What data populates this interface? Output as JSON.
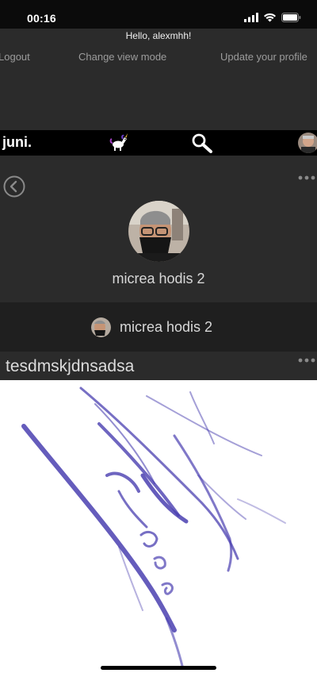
{
  "status_bar": {
    "time": "00:16",
    "icons": [
      "signal-icon",
      "wifi-icon",
      "battery-icon"
    ]
  },
  "header": {
    "greeting": "Hello, alexmhh!",
    "menu": {
      "logout_label": "Logout",
      "change_view_label": "Change view mode",
      "update_profile_label": "Update your profile"
    }
  },
  "nav": {
    "logo": "juni.",
    "icons": [
      "unicorn-icon",
      "search-icon",
      "avatar"
    ]
  },
  "profile": {
    "name": "micrea hodis 2",
    "back_icon": "chevron-left-circle-icon",
    "more_icon": "ellipsis-icon"
  },
  "post": {
    "author_name": "micrea hodis 2",
    "title": "tesdmskjdnsadsa",
    "more_icon": "ellipsis-icon",
    "image_description_icon": "handwriting-scribble-image"
  },
  "colors": {
    "background": "#2b2b2b",
    "nav_background": "#000000",
    "post_header_background": "#1f1f1f",
    "ink": "#4a3fb0",
    "menu_text": "#9c9c9c"
  }
}
